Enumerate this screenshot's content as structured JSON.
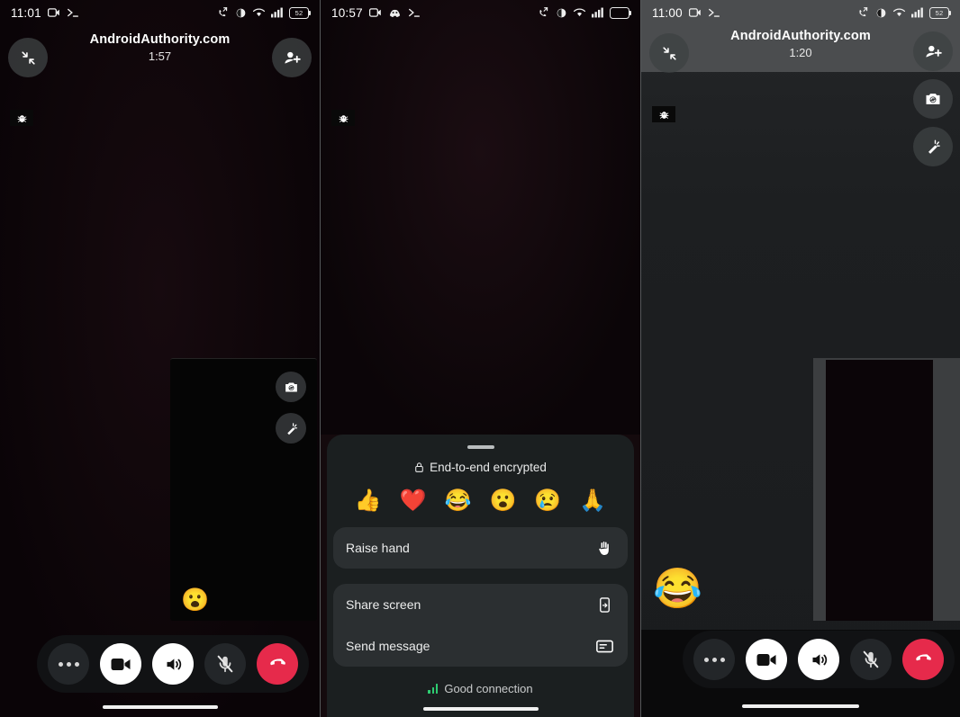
{
  "panels": [
    {
      "id": "panel-call-active",
      "status": {
        "time": "11:01",
        "battery": "52",
        "icons": [
          "camera-icon",
          "terminal-icon",
          "call-forward-icon",
          "vibrate-icon",
          "wifi-icon",
          "signal-icon",
          "battery-icon"
        ]
      },
      "header": {
        "title": "AndroidAuthority.com",
        "timer": "1:57"
      },
      "buttons": {
        "collapse": "collapse-icon",
        "add_person": "add-person-icon"
      },
      "pip": {
        "flip_camera": "flip-camera-icon",
        "effects": "effects-wand-icon",
        "reaction": "😮"
      },
      "controls": [
        {
          "name": "more-options",
          "icon": "three-dots-icon",
          "state": "dim"
        },
        {
          "name": "video-toggle",
          "icon": "video-camera-icon",
          "state": "light"
        },
        {
          "name": "speaker-toggle",
          "icon": "speaker-icon",
          "state": "light"
        },
        {
          "name": "mic-toggle",
          "icon": "mic-muted-icon",
          "state": "dim"
        },
        {
          "name": "end-call",
          "icon": "end-call-icon",
          "state": "danger"
        }
      ],
      "debug": "bug-icon"
    },
    {
      "id": "panel-options-sheet",
      "status": {
        "time": "10:57",
        "battery": "",
        "icons": [
          "camera-icon",
          "discord-icon",
          "terminal-icon",
          "call-forward-icon",
          "vibrate-icon",
          "wifi-icon",
          "signal-icon",
          "battery-icon"
        ]
      },
      "sheet": {
        "encrypted_label": "End-to-end encrypted",
        "encrypted_icon": "lock-icon",
        "emojis": [
          "👍",
          "❤️",
          "😂",
          "😮",
          "😢",
          "🙏"
        ],
        "rows": [
          {
            "label": "Raise hand",
            "icon": "raised-hand-icon",
            "group": 0
          },
          {
            "label": "Share screen",
            "icon": "share-screen-icon",
            "group": 1
          },
          {
            "label": "Send message",
            "icon": "message-icon",
            "group": 1
          }
        ],
        "connection": {
          "label": "Good connection",
          "icon": "signal-bars-icon",
          "color": "#2ecc71"
        }
      },
      "debug": "bug-icon"
    },
    {
      "id": "panel-reaction-sent",
      "status": {
        "time": "11:00",
        "battery": "52",
        "icons": [
          "camera-icon",
          "terminal-icon",
          "call-forward-icon",
          "vibrate-icon",
          "wifi-icon",
          "signal-icon",
          "battery-icon"
        ]
      },
      "header": {
        "title": "AndroidAuthority.com",
        "timer": "1:20"
      },
      "buttons": {
        "collapse": "collapse-icon",
        "add_person": "add-person-icon",
        "flip_camera": "flip-camera-icon",
        "effects": "effects-wand-icon"
      },
      "reaction": "😂",
      "controls": [
        {
          "name": "more-options",
          "icon": "three-dots-icon",
          "state": "dim"
        },
        {
          "name": "video-toggle",
          "icon": "video-camera-icon",
          "state": "light"
        },
        {
          "name": "speaker-toggle",
          "icon": "speaker-icon",
          "state": "light"
        },
        {
          "name": "mic-toggle",
          "icon": "mic-muted-icon",
          "state": "dim"
        },
        {
          "name": "end-call",
          "icon": "end-call-icon",
          "state": "danger"
        }
      ],
      "debug": "bug-icon"
    }
  ],
  "colors": {
    "accent_danger": "#e62a4b",
    "connection_good": "#2ecc71",
    "sheet_bg": "#1b1f20",
    "row_bg": "#2b2f31"
  }
}
